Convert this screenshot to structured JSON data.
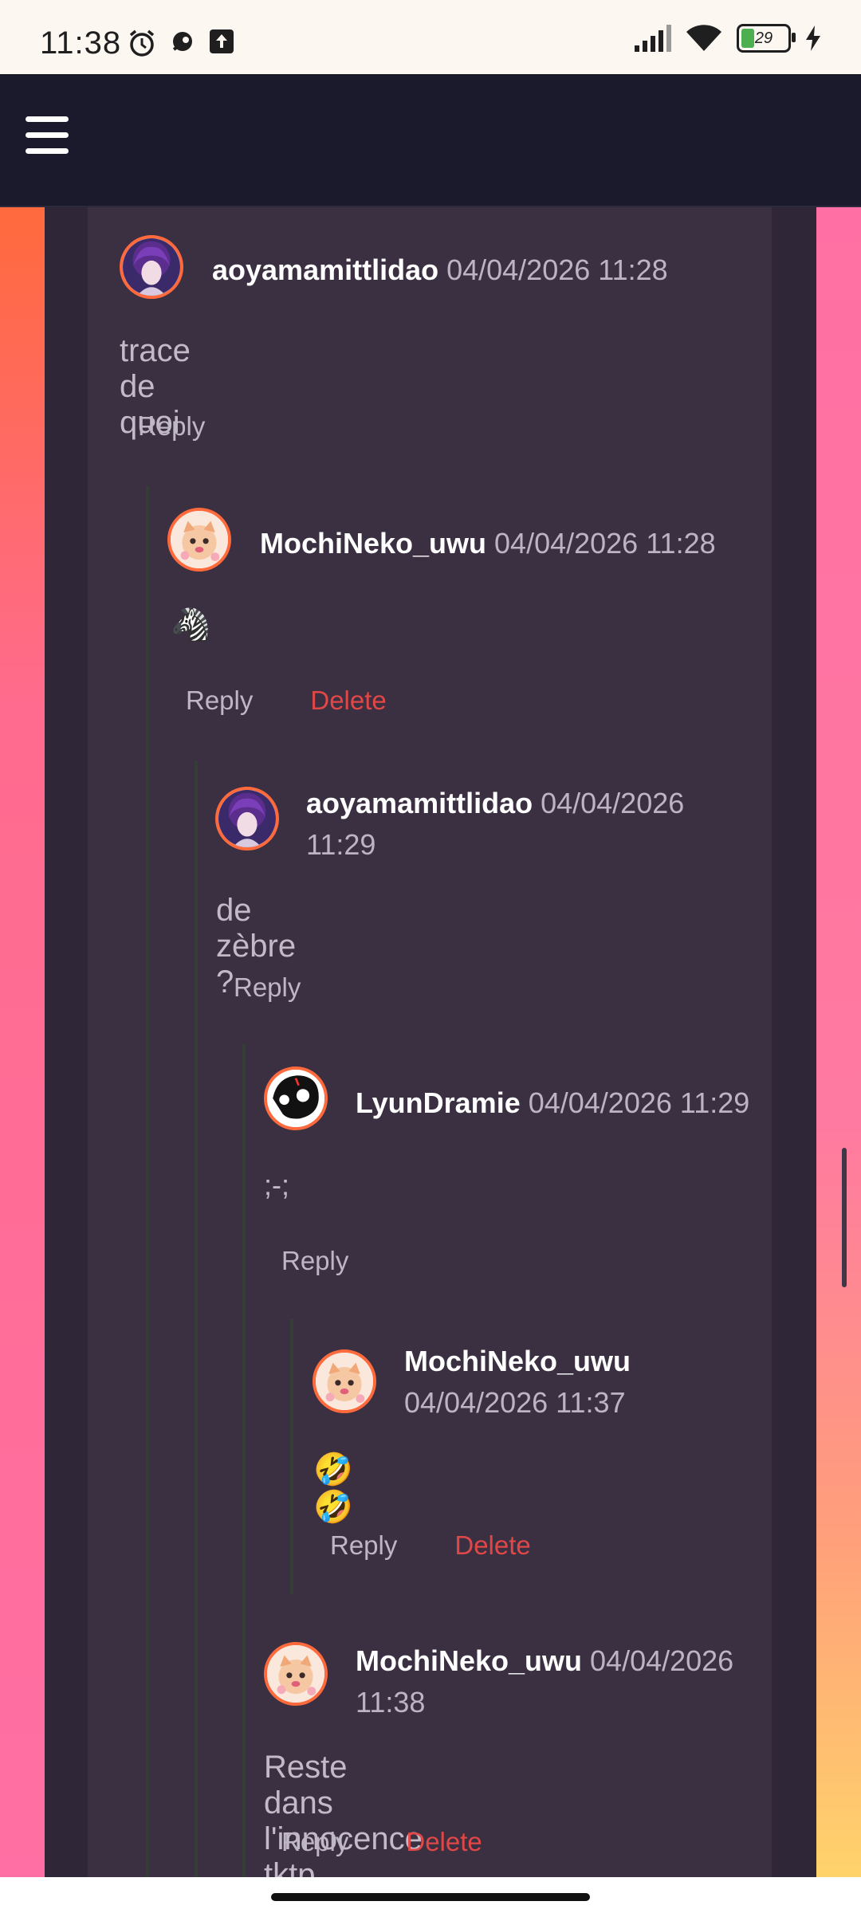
{
  "status_bar": {
    "time": "11:38",
    "battery": "29",
    "icons": [
      "alarm-icon",
      "chat-icon",
      "upload-icon",
      "signal-icon",
      "wifi-icon",
      "battery-icon",
      "charging-icon"
    ]
  },
  "app_bar": {
    "menu_icon": "hamburger-icon"
  },
  "colors": {
    "accent": "#ff6a3d",
    "delete": "#e04747",
    "card": "#3b2f42",
    "username": "#ffffff"
  },
  "labels": {
    "reply": "Reply",
    "delete": "Delete"
  },
  "comments": [
    {
      "username": "aoyamamittlidao",
      "timestamp": "04/04/2026 11:28",
      "text": "trace de quoi"
    },
    {
      "username": "MochiNeko_uwu",
      "timestamp": "04/04/2026 11:28",
      "text": "🦓"
    },
    {
      "username": "aoyamamittlidao",
      "timestamp": "04/04/2026 11:29",
      "text": "de zèbre ?"
    },
    {
      "username": "LyunDramie",
      "timestamp": "04/04/2026 11:29",
      "text": ";-;"
    },
    {
      "username": "MochiNeko_uwu",
      "timestamp": "04/04/2026 11:37",
      "text": "🤣🤣"
    },
    {
      "username": "MochiNeko_uwu",
      "timestamp": "04/04/2026 11:38",
      "text": "Reste dans l'innocence tktp"
    }
  ]
}
